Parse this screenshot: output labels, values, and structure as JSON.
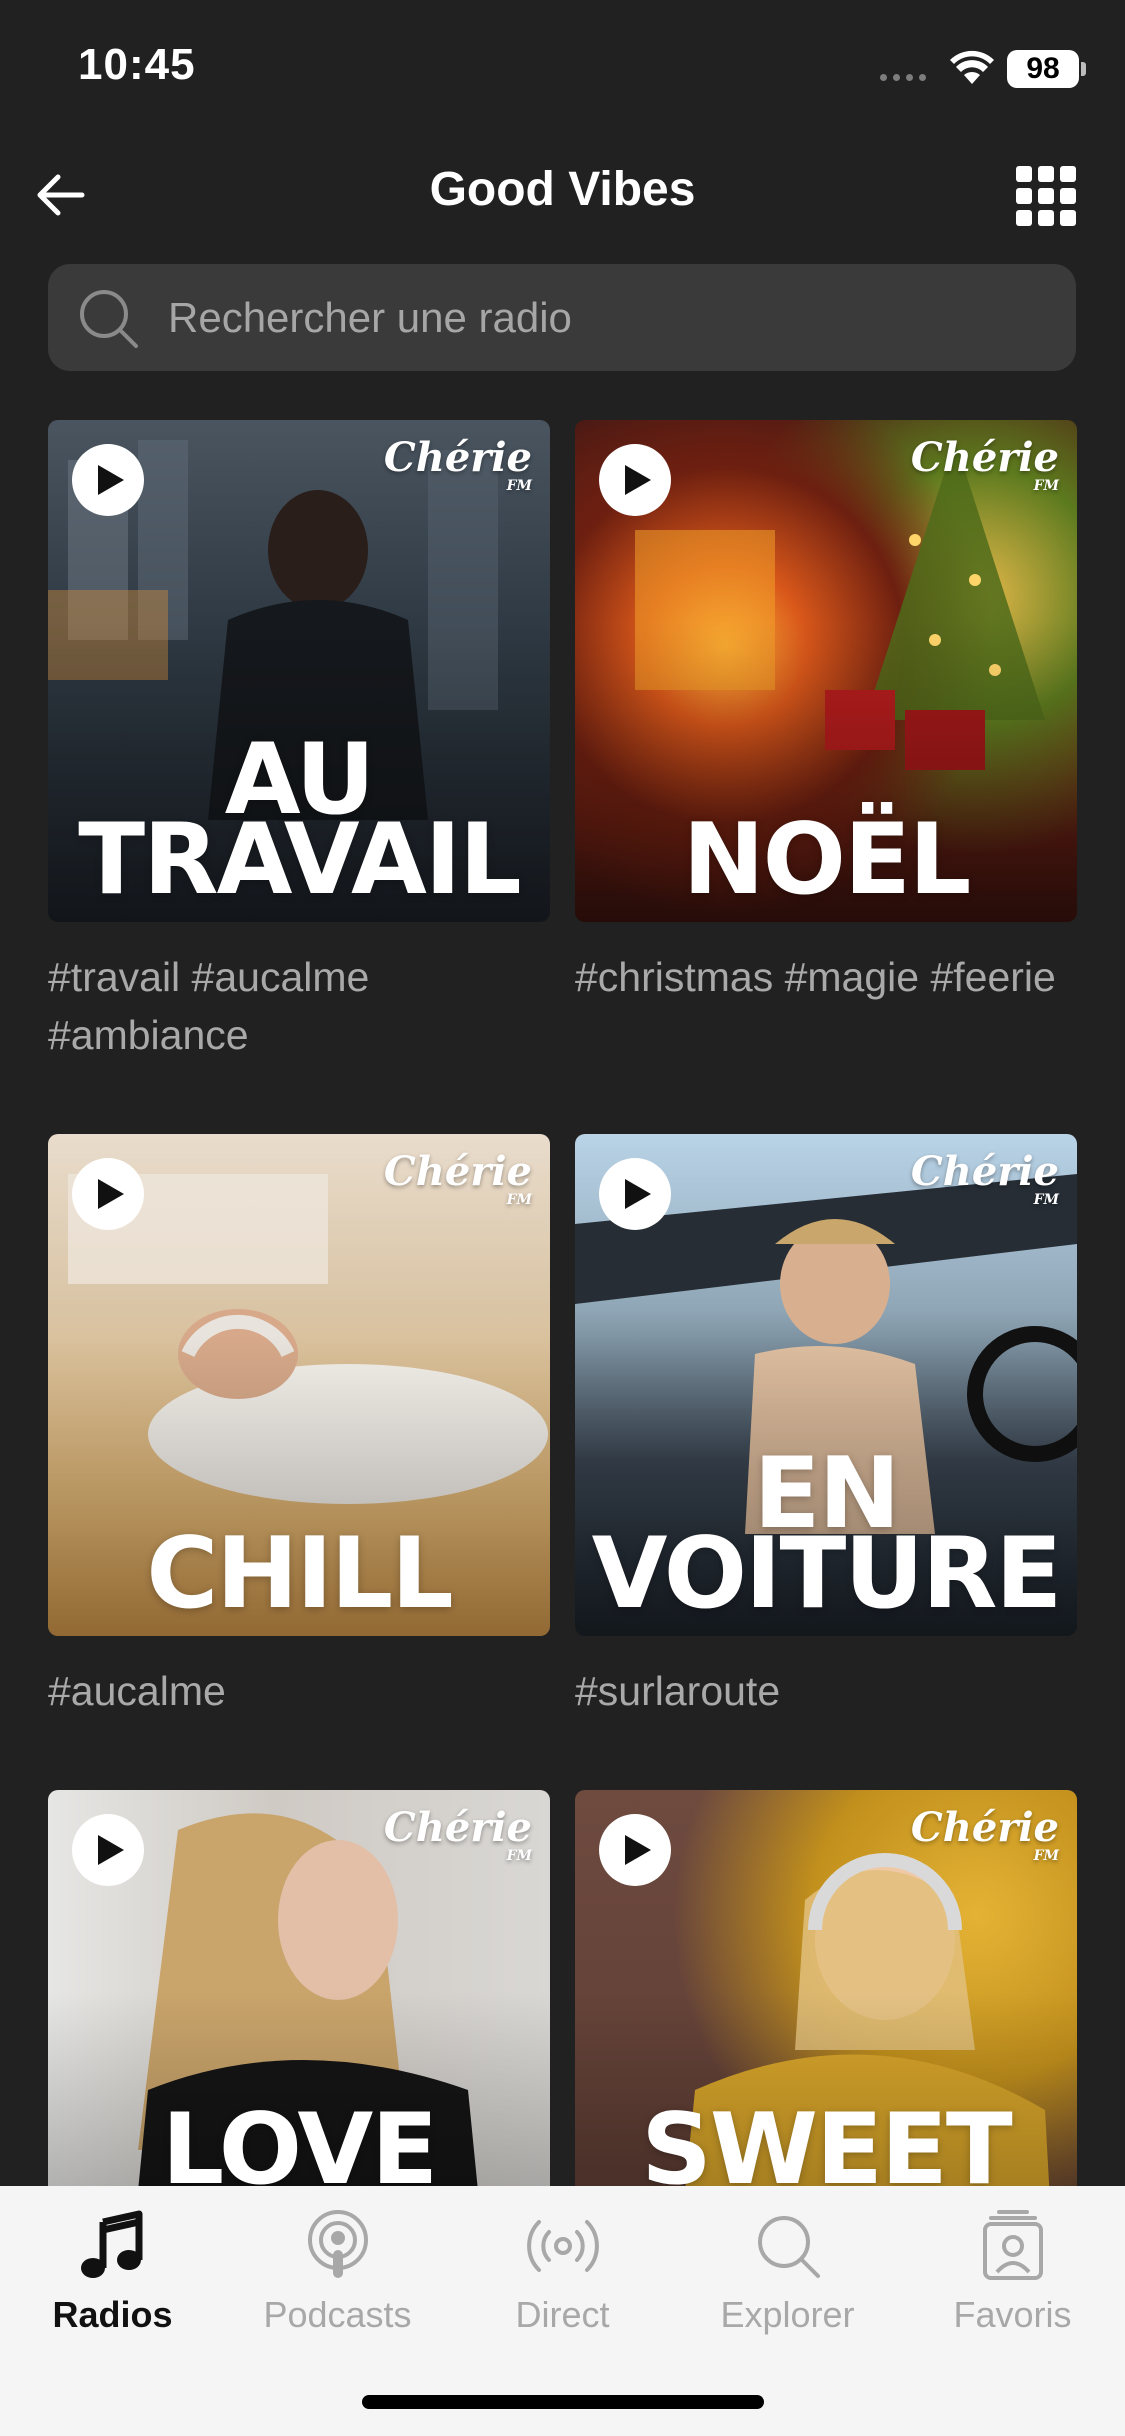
{
  "status_bar": {
    "time": "10:45",
    "battery": "98"
  },
  "header": {
    "title": "Good Vibes"
  },
  "search": {
    "placeholder": "Rechercher une radio"
  },
  "brand": {
    "name": "Chérie",
    "suffix": "FM"
  },
  "cards": [
    {
      "title": "AU\nTRAVAIL",
      "tags": "#travail #aucalme #ambiance"
    },
    {
      "title": "NOËL",
      "tags": "#christmas #magie #feerie"
    },
    {
      "title": "CHILL",
      "tags": "#aucalme"
    },
    {
      "title": "EN\nVOITURE",
      "tags": "#surlaroute"
    },
    {
      "title": "LOVE\nSONG",
      "tags": ""
    },
    {
      "title": "SWEET\nHOME",
      "tags": ""
    }
  ],
  "tab_bar": {
    "items": [
      {
        "label": "Radios",
        "icon": "music-note-icon",
        "active": true
      },
      {
        "label": "Podcasts",
        "icon": "podcast-icon",
        "active": false
      },
      {
        "label": "Direct",
        "icon": "broadcast-icon",
        "active": false
      },
      {
        "label": "Explorer",
        "icon": "search-icon",
        "active": false
      },
      {
        "label": "Favoris",
        "icon": "favorites-icon",
        "active": false
      }
    ]
  },
  "colors": {
    "background": "#212121",
    "search_background": "#3a3a3a",
    "tab_bar_background": "#f5f5f5",
    "tag_text": "#a9a9a9",
    "tab_inactive": "#a8a8a8",
    "tab_active": "#111111"
  }
}
